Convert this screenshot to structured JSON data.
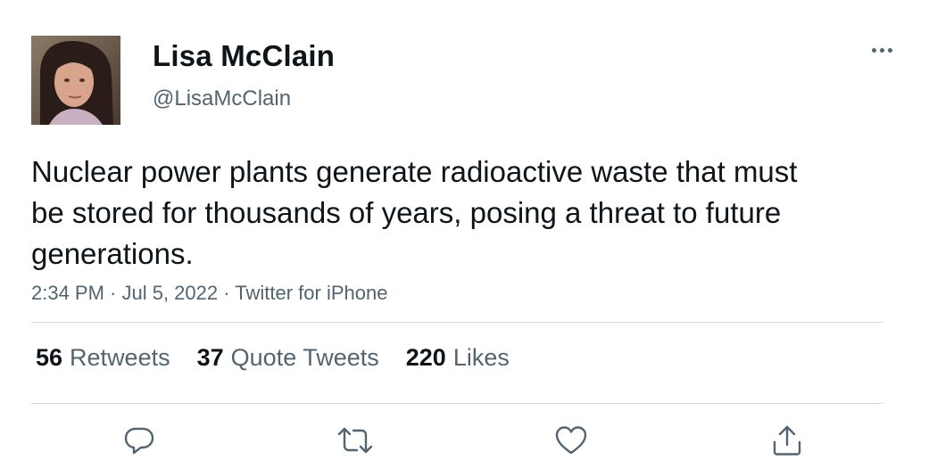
{
  "author": {
    "display_name": "Lisa McClain",
    "handle": "@LisaMcClain"
  },
  "tweet": {
    "text": "Nuclear power plants generate radioactive waste that must be stored for thousands of years, posing a threat to future generations.",
    "meta": "2:34 PM · Jul 5, 2022 · Twitter for iPhone"
  },
  "stats": {
    "retweets_count": "56",
    "retweets_label": "Retweets",
    "quotes_count": "37",
    "quotes_label": "Quote Tweets",
    "likes_count": "220",
    "likes_label": "Likes"
  },
  "actions": [
    "reply-icon",
    "retweet-icon",
    "like-icon",
    "share-icon"
  ],
  "colors": {
    "text": "#0f1419",
    "secondary": "#536471",
    "divider": "#cfd9de"
  }
}
